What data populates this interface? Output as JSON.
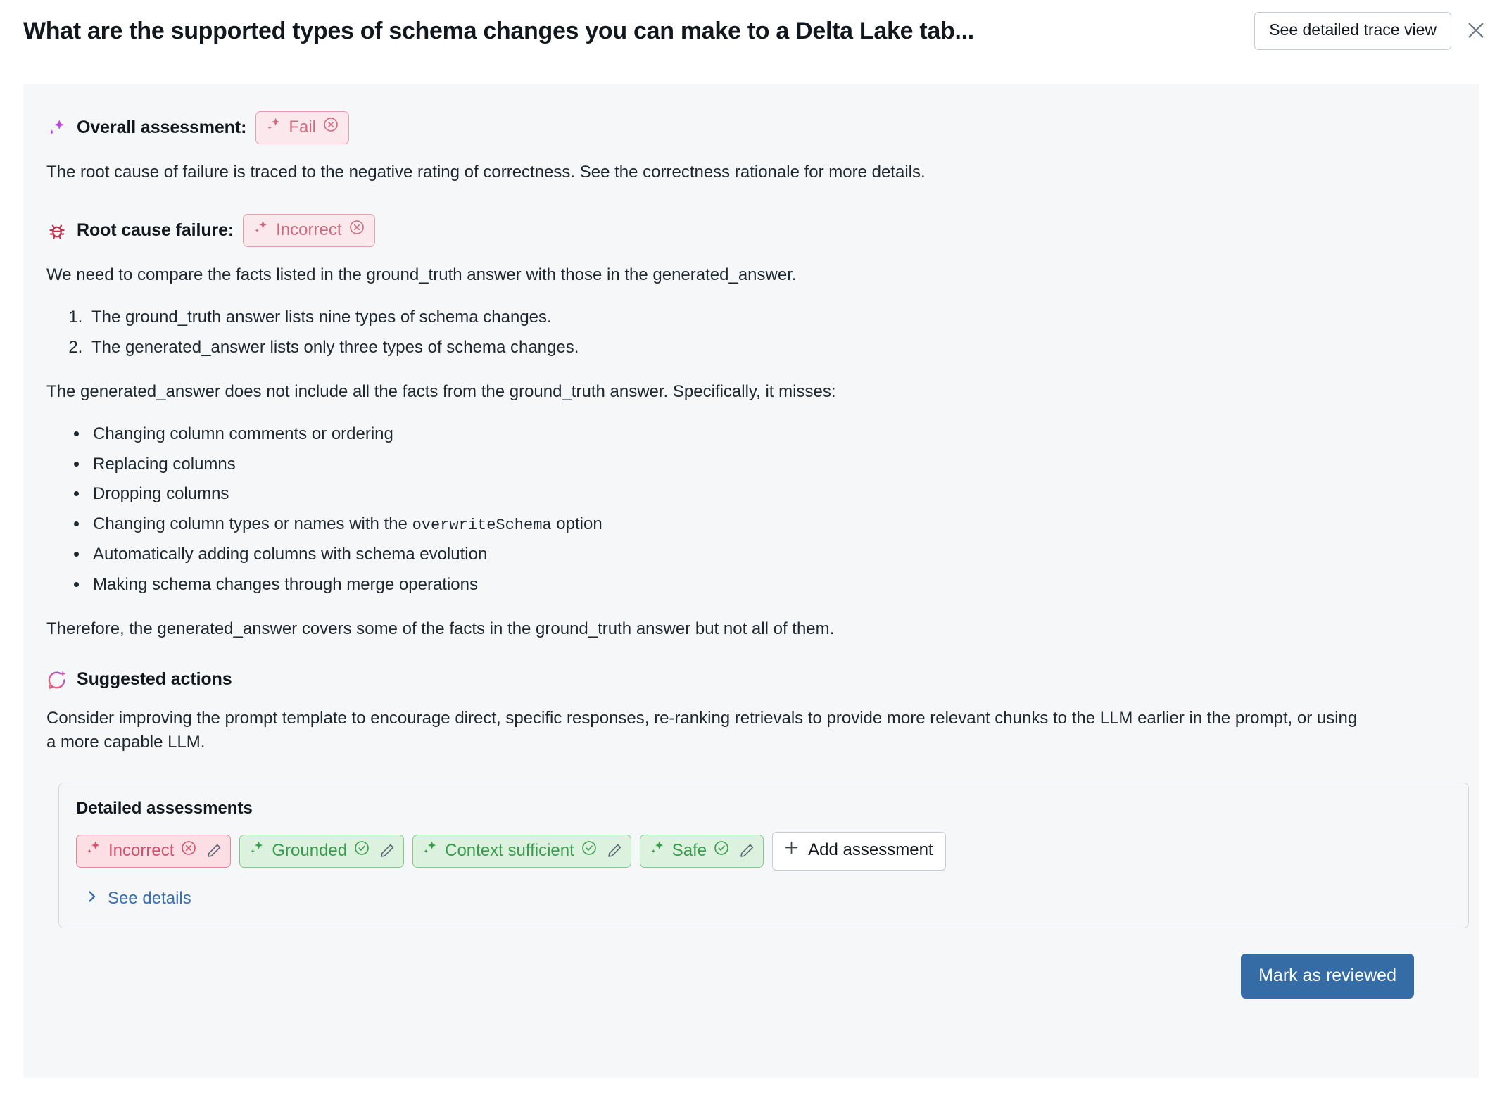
{
  "header": {
    "title": "What are the supported types of schema changes you can make to a Delta Lake tab...",
    "trace_button": "See detailed trace view",
    "close_icon": "close-icon"
  },
  "overall": {
    "label": "Overall assessment:",
    "icon": "sparkle-icon",
    "badge": {
      "text": "Fail",
      "sparkle_icon": "sparkle-icon",
      "status_icon": "x-circle-icon"
    },
    "description": "The root cause of failure is traced to the negative rating of correctness. See the correctness rationale for more details."
  },
  "root_cause": {
    "label": "Root cause failure:",
    "icon": "bug-icon",
    "badge": {
      "text": "Incorrect",
      "sparkle_icon": "sparkle-icon",
      "status_icon": "x-circle-icon"
    },
    "intro": "We need to compare the facts listed in the ground_truth answer with those in the generated_answer.",
    "numbered": [
      "The ground_truth answer lists nine types of schema changes.",
      "The generated_answer lists only three types of schema changes."
    ],
    "misses_intro": "The generated_answer does not include all the facts from the ground_truth answer. Specifically, it misses:",
    "misses": [
      {
        "pre": "Changing column comments or ordering",
        "code": "",
        "post": ""
      },
      {
        "pre": "Replacing columns",
        "code": "",
        "post": ""
      },
      {
        "pre": "Dropping columns",
        "code": "",
        "post": ""
      },
      {
        "pre": "Changing column types or names with the ",
        "code": "overwriteSchema",
        "post": " option"
      },
      {
        "pre": "Automatically adding columns with schema evolution",
        "code": "",
        "post": ""
      },
      {
        "pre": "Making schema changes through merge operations",
        "code": "",
        "post": ""
      }
    ],
    "conclusion": "Therefore, the generated_answer covers some of the facts in the ground_truth answer but not all of them."
  },
  "suggested": {
    "label": "Suggested actions",
    "icon": "chat-sparkle-icon",
    "text": "Consider improving the prompt template to encourage direct, specific responses, re-ranking retrievals to provide more relevant chunks to the LLM earlier in the prompt, or using a more capable LLM."
  },
  "detailed": {
    "title": "Detailed assessments",
    "chips": [
      {
        "label": "Incorrect",
        "tone": "bad",
        "status_icon": "x-circle-icon",
        "edit_icon": "pencil-icon"
      },
      {
        "label": "Grounded",
        "tone": "good",
        "status_icon": "check-circle-icon",
        "edit_icon": "pencil-icon"
      },
      {
        "label": "Context sufficient",
        "tone": "good",
        "status_icon": "check-circle-icon",
        "edit_icon": "pencil-icon"
      },
      {
        "label": "Safe",
        "tone": "good",
        "status_icon": "check-circle-icon",
        "edit_icon": "pencil-icon"
      }
    ],
    "add_label": "Add assessment",
    "add_icon": "plus-icon",
    "see_details": "See details",
    "see_details_icon": "chevron-right-icon"
  },
  "footer": {
    "review_label": "Mark as reviewed"
  },
  "colors": {
    "panel_bg": "#f6f7f8",
    "fail_text": "#cc6b80",
    "fail_bg": "#fbe8ec",
    "bad_text": "#d2506b",
    "bad_bg": "#fbdfe4",
    "good_text": "#3a9b4e",
    "good_bg": "#dcf2df",
    "primary_button": "#356ca6",
    "link": "#3a6fb0",
    "bug_icon": "#c1304c"
  }
}
